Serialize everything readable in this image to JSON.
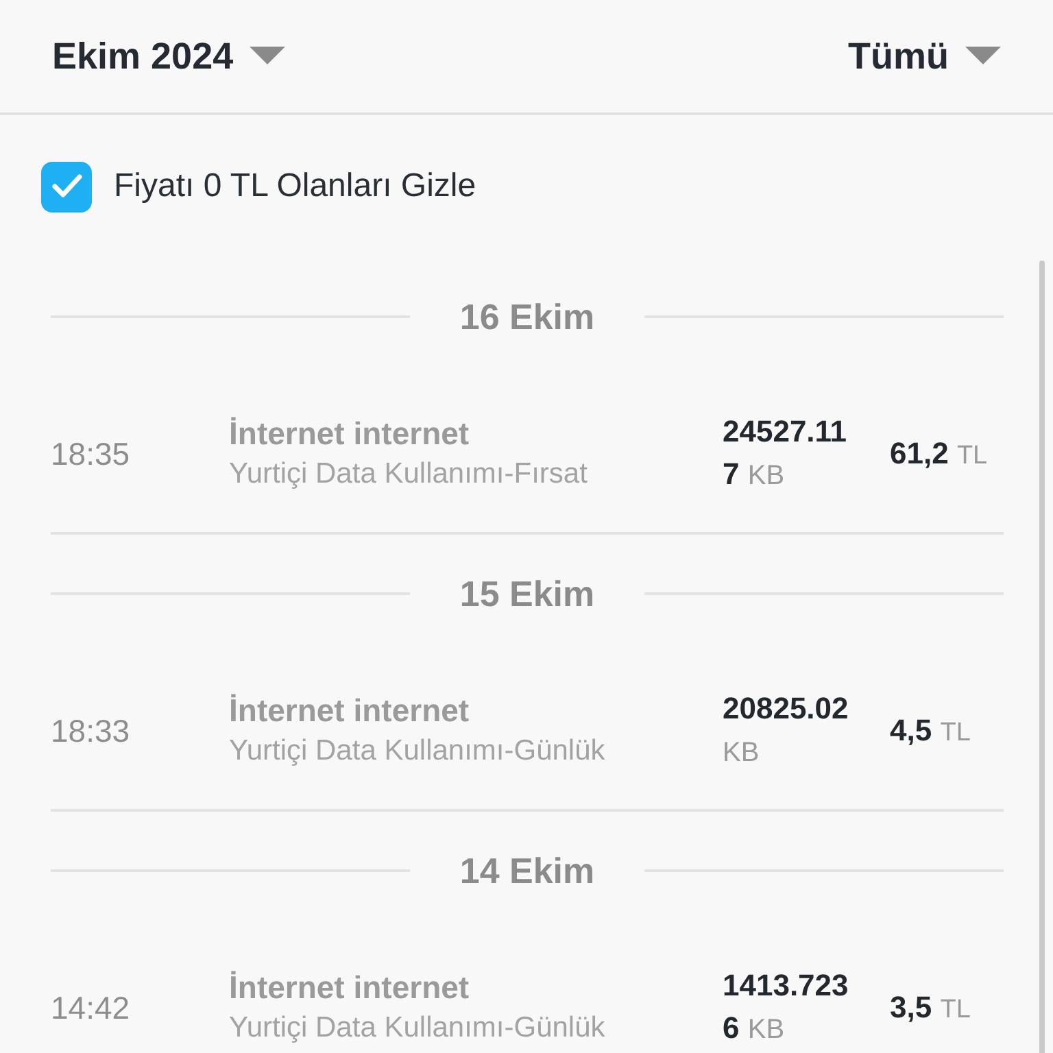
{
  "header": {
    "month": "Ekim 2024",
    "filter": "Tümü"
  },
  "hide_zero": {
    "label": "Fiyatı 0 TL Olanları Gizle",
    "checked": true
  },
  "days": [
    {
      "date": "16 Ekim",
      "rows": [
        {
          "time": "18:35",
          "title": "İnternet internet",
          "subtitle": "Yurtiçi Data Kullanımı-Fırsat",
          "amount": "24527.117",
          "unit": "KB",
          "price": "61,2",
          "currency": "TL"
        }
      ]
    },
    {
      "date": "15 Ekim",
      "rows": [
        {
          "time": "18:33",
          "title": "İnternet internet",
          "subtitle": "Yurtiçi Data Kullanımı-Günlük",
          "amount": "20825.02",
          "unit": "KB",
          "price": "4,5",
          "currency": "TL"
        }
      ]
    },
    {
      "date": "14 Ekim",
      "rows": [
        {
          "time": "14:42",
          "title": "İnternet internet",
          "subtitle": "Yurtiçi Data Kullanımı-Günlük",
          "amount": "1413.7236",
          "unit": "KB",
          "price": "3,5",
          "currency": "TL"
        }
      ]
    }
  ]
}
